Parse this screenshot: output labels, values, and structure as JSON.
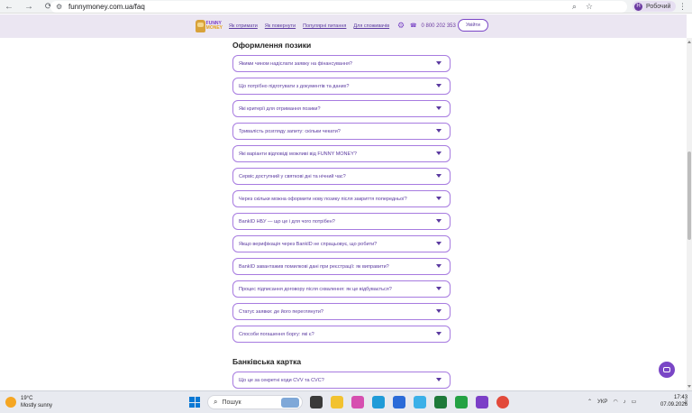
{
  "browser": {
    "url": "funnymoney.com.ua/faq",
    "profile_initial": "Н",
    "profile_label": "Робочий"
  },
  "header": {
    "logo_line1": "FUNNY",
    "logo_line2": "MONEY",
    "menu": [
      {
        "label": "Як отримати"
      },
      {
        "label": "Як повернути"
      },
      {
        "label": "Популярні питання"
      },
      {
        "label": "Для споживачів"
      }
    ],
    "phone": "0 800 202 353",
    "login_label": "Увійти"
  },
  "sections": [
    {
      "title": "Оформлення позики",
      "items": [
        "Якими чином надіслати заявку на фінансування?",
        "Що потрібно підготувати з документів та даних?",
        "Які критерії для отримання позики?",
        "Тривалість розгляду запиту: скільки чекати?",
        "Які варіанти відповіді можливі від FUNNY MONEY?",
        "Сервіс доступний у святкові дні та нічний час?",
        "Через скільки можна оформити нову позику після закриття попередньої?",
        "BankID НБУ — що це і для чого потрібен?",
        "Якщо верифікація через BankID не спрацьовує, що робити?",
        "BankID завантажив помилкові дані при реєстрації: як виправити?",
        "Процес підписання договору після схвалення: як це відбувається?",
        "Статус заявки: де його переглянути?",
        "Способи погашення боргу: які є?"
      ]
    },
    {
      "title": "Банківська картка",
      "items": [
        "Що це за секретні коди CVV та CVC?"
      ]
    }
  ],
  "taskbar": {
    "temperature": "19°C",
    "weather": "Mostly sunny",
    "search_placeholder": "Пошук",
    "language": "УКР",
    "time": "17:43",
    "date": "07.09.2026"
  },
  "colors": {
    "accent": "#7a46c6",
    "header_bg": "#ebe6f2",
    "faq_border": "#a77be0"
  }
}
